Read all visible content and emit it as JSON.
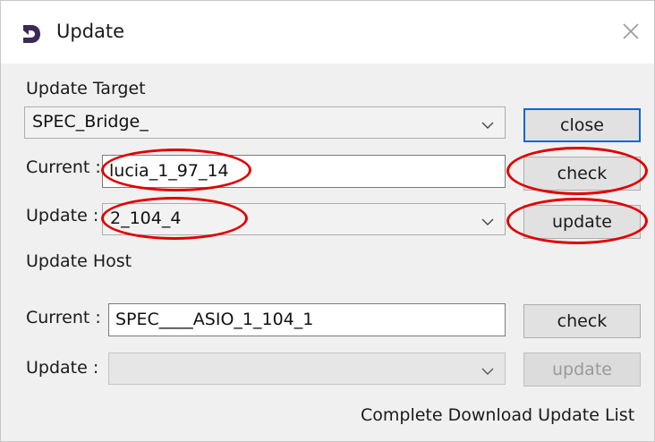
{
  "window": {
    "title": "Update",
    "icon": "app-logo-icon",
    "close_icon": "close-icon"
  },
  "update_target": {
    "section_label": "Update Target",
    "target_select": {
      "value": "SPEC_Bridge_"
    },
    "close_label": "close",
    "current_label": "Current :",
    "current_value": "lucia_1_97_14",
    "check_label": "check",
    "update_label": "Update :",
    "update_select": {
      "value": "2_104_4"
    },
    "update_button_label": "update"
  },
  "update_host": {
    "section_label": "Update Host",
    "current_label": "Current :",
    "current_value": "SPEC____ASIO_1_104_1",
    "check_label": "check",
    "update_label": "Update :",
    "update_select": {
      "value": ""
    },
    "update_button_label": "update",
    "update_button_enabled": false
  },
  "footer": {
    "link_label": "Complete Download Update List"
  },
  "colors": {
    "annotation": "#e00000",
    "default_button_border": "#0a66d6",
    "logo": "#3a2a55"
  }
}
